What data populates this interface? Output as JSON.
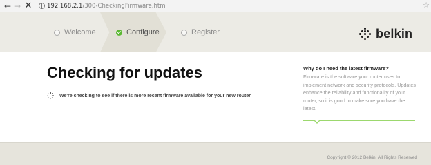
{
  "browser": {
    "back_icon": "back-arrow-icon",
    "forward_icon": "forward-arrow-icon",
    "stop_icon": "stop-icon",
    "url_host": "192.168.2.1",
    "url_path": "/300-CheckingFirmware.htm",
    "bookmark_icon": "star-icon"
  },
  "header": {
    "steps": [
      {
        "label": "Welcome",
        "state": "pending"
      },
      {
        "label": "Configure",
        "state": "complete"
      },
      {
        "label": "Register",
        "state": "pending"
      }
    ],
    "logo_text": "belkin",
    "accent_green": "#5bb832"
  },
  "main": {
    "title": "Checking for updates",
    "status_text": "We're checking to see if there is more recent firmware available for your new router"
  },
  "sidebar": {
    "title": "Why do I need the latest firmware?",
    "body": "Firmware is the software your router uses to implement network and security protocols. Updates enhance the reliability and functionality of your router, so it is good to make sure you have the latest."
  },
  "footer": {
    "copyright": "Copyright © 2012  Belkin. All Rights Reserved"
  }
}
